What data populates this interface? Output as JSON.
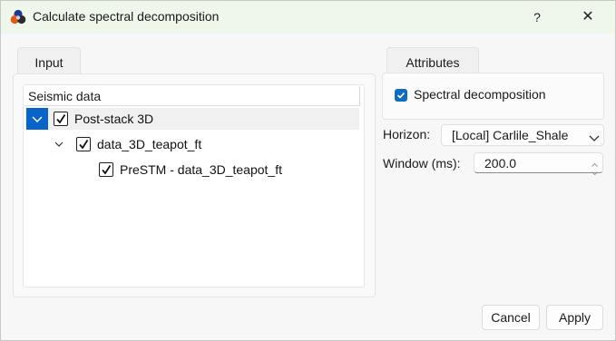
{
  "window": {
    "title": "Calculate spectral decomposition",
    "help_label": "?",
    "close_label": "✕"
  },
  "tabs": {
    "input": "Input",
    "attributes": "Attributes"
  },
  "tree": {
    "header": "Seismic data",
    "items": [
      {
        "label": "Post-stack 3D",
        "checked": true,
        "expanded": true,
        "selected": true
      },
      {
        "label": "data_3D_teapot_ft",
        "checked": true,
        "expanded": true
      },
      {
        "label": "PreSTM - data_3D_teapot_ft",
        "checked": true
      }
    ]
  },
  "attributes": {
    "spectral_decomposition": {
      "label": "Spectral decomposition",
      "checked": true
    },
    "horizon": {
      "label": "Horizon:",
      "value": "[Local] Carlile_Shale"
    },
    "window": {
      "label": "Window (ms):",
      "value": "200.0"
    }
  },
  "buttons": {
    "cancel": "Cancel",
    "apply": "Apply"
  },
  "colors": {
    "titlebar": "#eef7e9",
    "accent": "#0f6cbd",
    "selection": "#0a64c8"
  }
}
